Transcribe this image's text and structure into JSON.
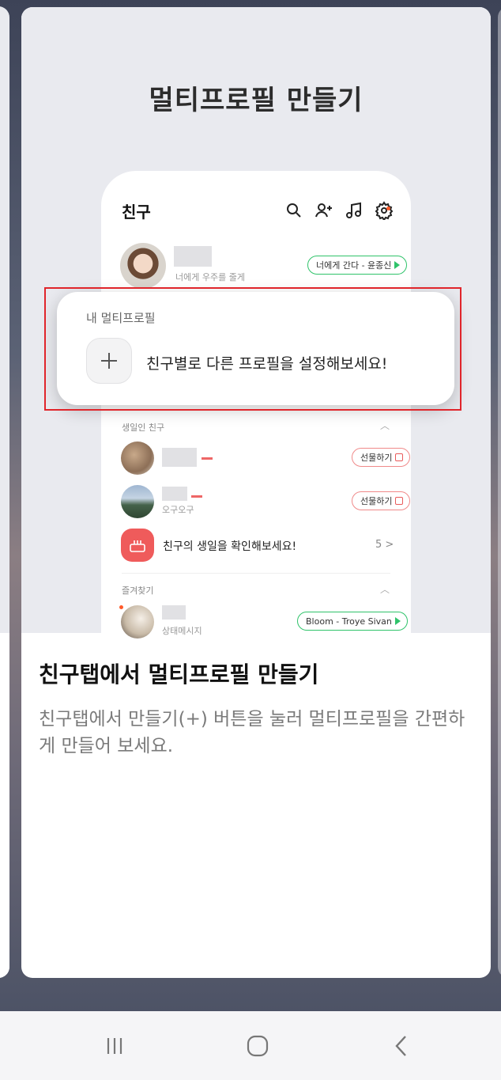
{
  "hero": {
    "title": "멀티프로필 만들기"
  },
  "phone": {
    "header_title": "친구",
    "icons": [
      "search-icon",
      "add-friend-icon",
      "music-icon",
      "settings-icon"
    ],
    "my_profile": {
      "status": "너에게 우주를 줄게",
      "music": "너에게 간다 - 윤종신"
    },
    "birthday_section": {
      "label": "생일인 친구",
      "rows": [
        {
          "status": "",
          "button": "선물하기"
        },
        {
          "status": "오구오구",
          "button": "선물하기"
        }
      ],
      "check_row": {
        "text": "친구의 생일을 확인해보세요!",
        "count": "5 >"
      }
    },
    "favorites_section": {
      "label": "즐겨찾기",
      "row": {
        "status": "상태메시지",
        "music": "Bloom - Troye Sivan"
      }
    }
  },
  "popup": {
    "label": "내 멀티프로필",
    "message": "친구별로 다른 프로필을 설정해보세요!"
  },
  "bottom": {
    "title": "친구탭에서 멀티프로필 만들기",
    "description": "친구탭에서 만들기(+) 버튼을 눌러 멀티프로필을 간편하게 만들어 보세요."
  },
  "navbar": {
    "icons": [
      "recent-apps-icon",
      "home-icon",
      "back-icon"
    ]
  },
  "colors": {
    "accent_green": "#2fc36a",
    "highlight_red": "#e0252b",
    "birthday_red": "#ef5b5b"
  }
}
